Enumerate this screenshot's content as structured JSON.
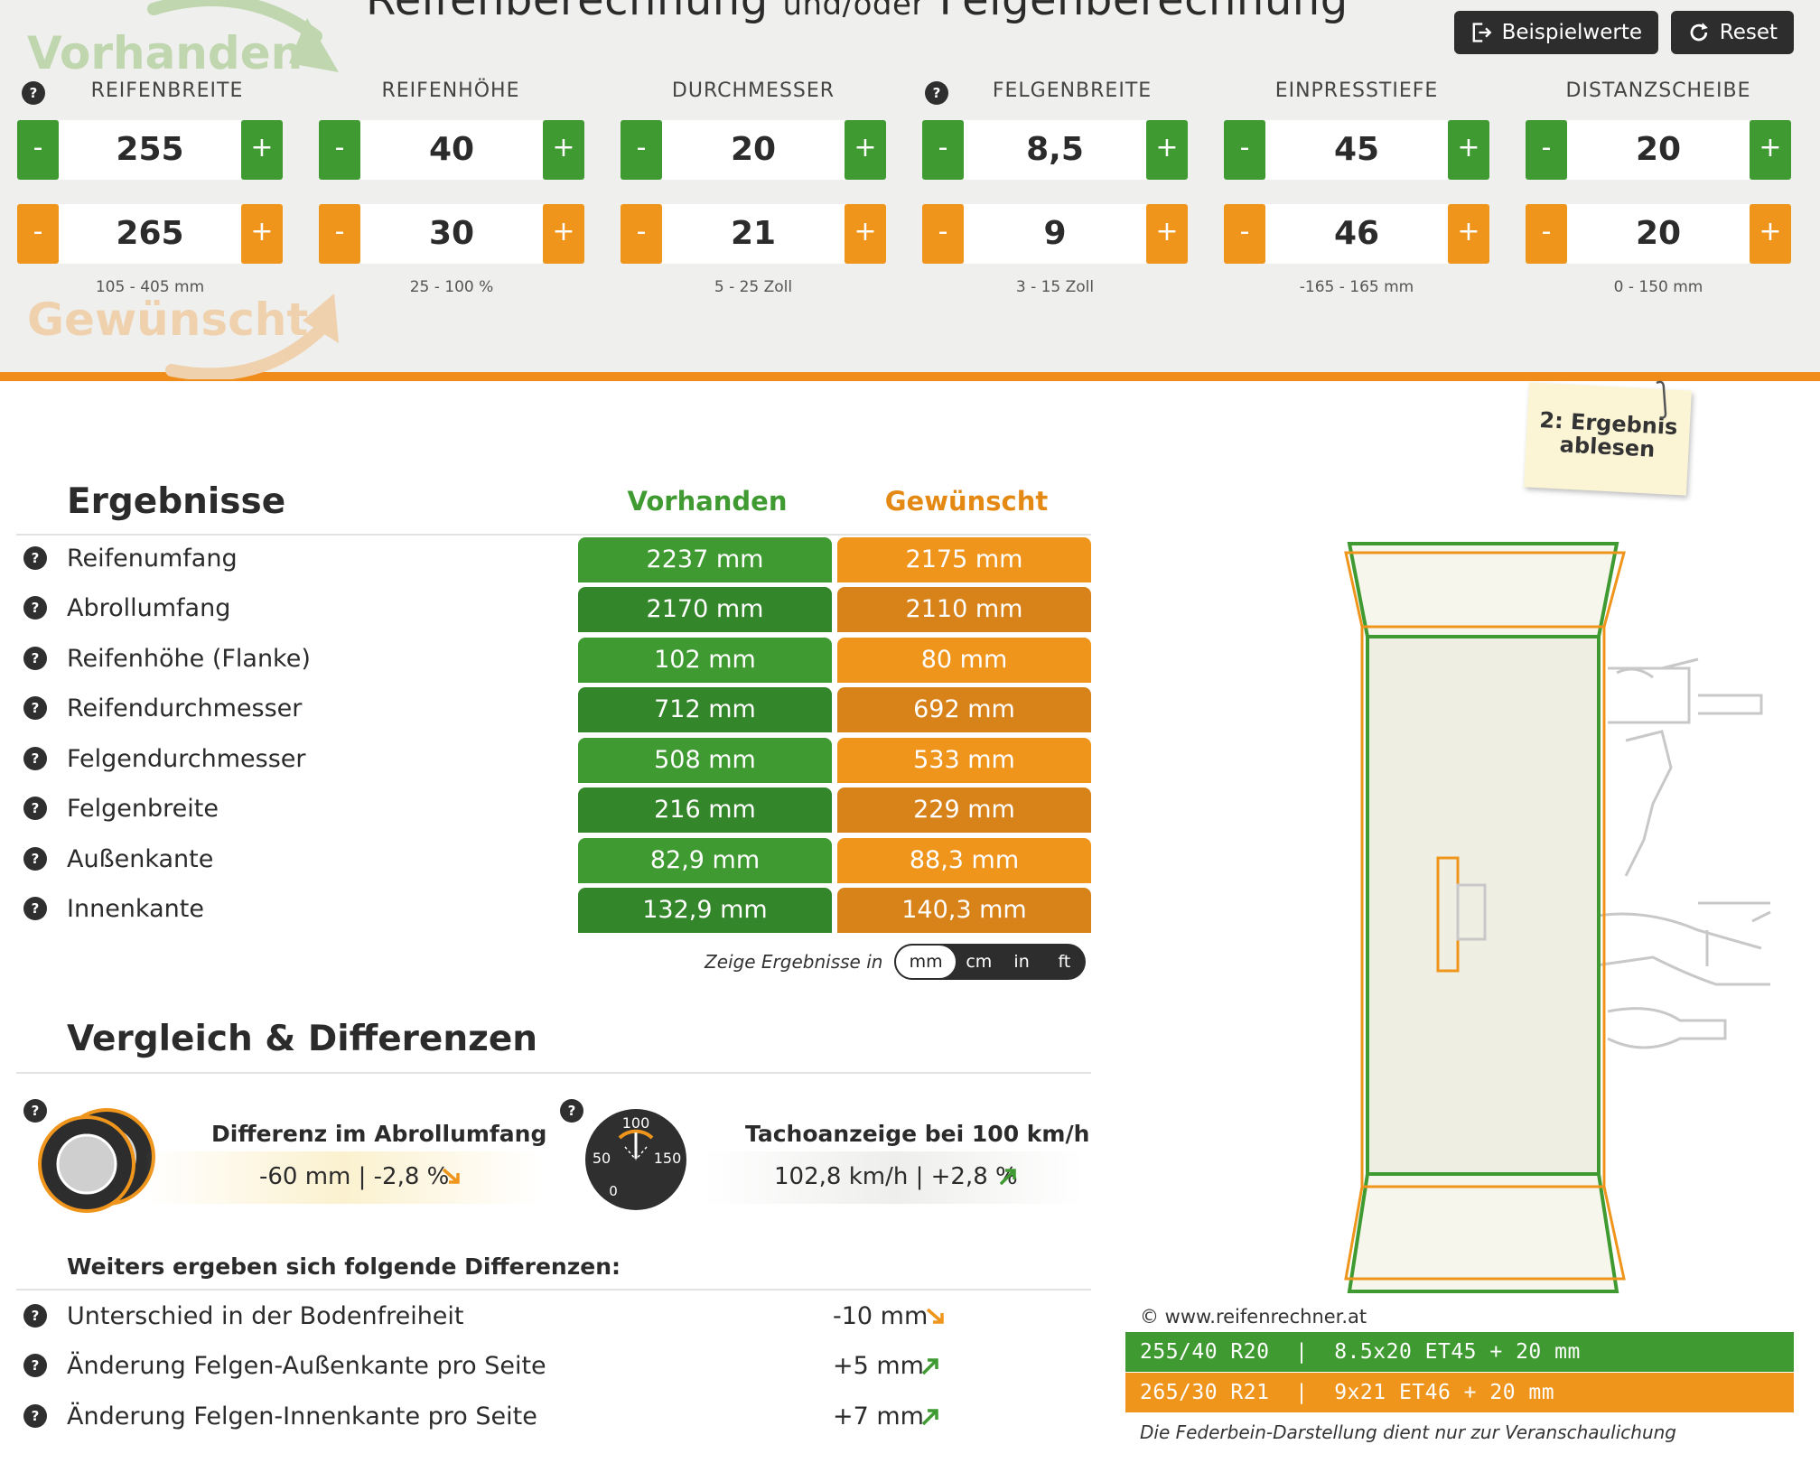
{
  "header": {
    "title_main_1": "Reifenberechnung",
    "title_small": "und/oder",
    "title_main_2": "Felgenberechnung",
    "watermark_current": "Vorhanden",
    "watermark_desired": "Gewünscht",
    "example_button": "Beispielwerte",
    "reset_button": "Reset"
  },
  "columns": [
    {
      "label": "REIFENBREITE",
      "current": "255",
      "desired": "265",
      "range": "105 - 405 mm"
    },
    {
      "label": "REIFENHÖHE",
      "current": "40",
      "desired": "30",
      "range": "25 - 100 %"
    },
    {
      "label": "DURCHMESSER",
      "current": "20",
      "desired": "21",
      "range": "5 - 25 Zoll"
    },
    {
      "label": "FELGENBREITE",
      "current": "8,5",
      "desired": "9",
      "range": "3 - 15 Zoll"
    },
    {
      "label": "EINPRESSTIEFE",
      "current": "45",
      "desired": "46",
      "range": "-165 - 165 mm"
    },
    {
      "label": "DISTANZSCHEIBE",
      "current": "20",
      "desired": "20",
      "range": "0 - 150 mm"
    }
  ],
  "stepper": {
    "minus": "-",
    "plus": "+"
  },
  "help_glyph": "?",
  "note": {
    "line1": "2: Ergebnis",
    "line2": "ablesen"
  },
  "results": {
    "title": "Ergebnisse",
    "col_current": "Vorhanden",
    "col_desired": "Gewünscht",
    "rows": [
      {
        "label": "Reifenumfang",
        "current": "2237 mm",
        "desired": "2175 mm"
      },
      {
        "label": "Abrollumfang",
        "current": "2170 mm",
        "desired": "2110 mm"
      },
      {
        "label": "Reifenhöhe (Flanke)",
        "current": "102 mm",
        "desired": "80 mm"
      },
      {
        "label": "Reifendurchmesser",
        "current": "712 mm",
        "desired": "692 mm"
      },
      {
        "label": "Felgendurchmesser",
        "current": "508 mm",
        "desired": "533 mm"
      },
      {
        "label": "Felgenbreite",
        "current": "216 mm",
        "desired": "229 mm"
      },
      {
        "label": "Außenkante",
        "current": "82,9 mm",
        "desired": "88,3 mm"
      },
      {
        "label": "Innenkante",
        "current": "132,9 mm",
        "desired": "140,3 mm"
      }
    ],
    "units_label": "Zeige Ergebnisse in",
    "units": [
      "mm",
      "cm",
      "in",
      "ft"
    ],
    "active_unit": "mm"
  },
  "comparison": {
    "title": "Vergleich & Differenzen",
    "rolling_title": "Differenz im Abrollumfang",
    "rolling_value": "-60 mm | -2,8 %",
    "speedo_title": "Tachoanzeige bei 100 km/h",
    "speedo_value": "102,8 km/h | +2,8 %",
    "gauge": {
      "top": "100",
      "left": "50",
      "right": "150",
      "bottom": "0"
    },
    "further_title": "Weiters ergeben sich folgende Differenzen:",
    "further": [
      {
        "label": "Unterschied in der Bodenfreiheit",
        "value": "-10 mm",
        "direction": "down"
      },
      {
        "label": "Änderung Felgen-Außenkante pro Seite",
        "value": "+5 mm",
        "direction": "up"
      },
      {
        "label": "Änderung Felgen-Innenkante pro Seite",
        "value": "+7 mm",
        "direction": "up"
      }
    ]
  },
  "diagram": {
    "copyright": "© www.reifenrechner.at",
    "spec_current": "255/40 R20  |  8.5x20 ET45 + 20 mm",
    "spec_desired": "265/30 R21  |  9x21 ET46 + 20 mm",
    "disclaimer": "Die Federbein-Darstellung dient nur zur Veranschaulichung"
  },
  "colors": {
    "green": "#3f9b31",
    "green_dark": "#34862a",
    "orange": "#ef951c",
    "orange_dark": "#d7831a",
    "accent_bar": "#ef8c1a"
  }
}
